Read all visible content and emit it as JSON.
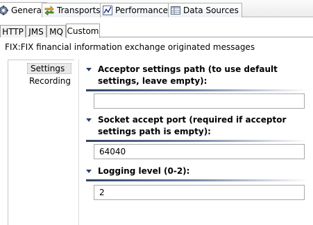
{
  "top_tabs": [
    {
      "label": "General",
      "icon": "gear-icon",
      "selected": true
    },
    {
      "label": "Transports",
      "icon": "transports-icon",
      "selected": false
    },
    {
      "label": "Performance",
      "icon": "performance-icon",
      "selected": false
    },
    {
      "label": "Data Sources",
      "icon": "data-sources-icon",
      "selected": false
    }
  ],
  "sub_tabs": [
    {
      "label": "HTTP",
      "selected": false
    },
    {
      "label": "JMS",
      "selected": false
    },
    {
      "label": "MQ",
      "selected": false
    },
    {
      "label": "Custom",
      "selected": true
    }
  ],
  "description": "FIX:FIX financial information exchange originated messages",
  "nav": {
    "items": [
      {
        "label": "Settings",
        "selected": true
      },
      {
        "label": "Recording",
        "selected": false
      }
    ]
  },
  "sections": {
    "acceptor": {
      "title": "Acceptor settings path (to use default settings, leave empty):",
      "value": ""
    },
    "socket_port": {
      "title": "Socket accept port (required if acceptor settings path is empty):",
      "value": "64040"
    },
    "logging": {
      "title": "Logging level (0-2):",
      "value": "2"
    }
  },
  "colors": {
    "section_title_accent": "#2f4466"
  }
}
